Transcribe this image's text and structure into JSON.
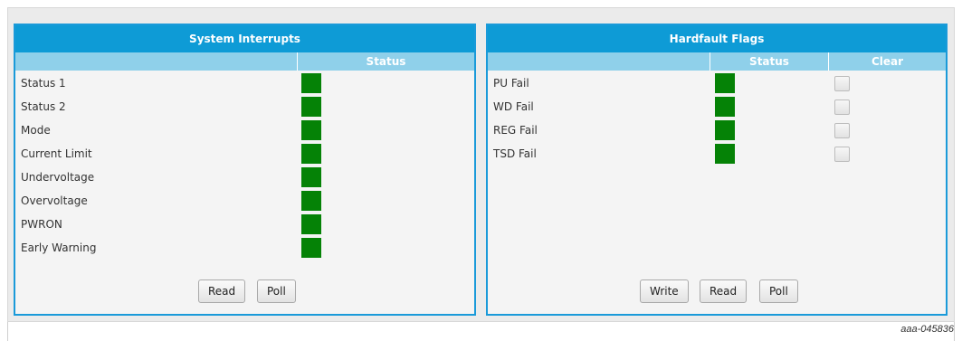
{
  "system_interrupts": {
    "title": "System Interrupts",
    "columns": [
      "",
      "Status"
    ],
    "rows": [
      {
        "label": "Status 1",
        "status_color": "#058206"
      },
      {
        "label": "Status 2",
        "status_color": "#058206"
      },
      {
        "label": "Mode",
        "status_color": "#058206"
      },
      {
        "label": "Current Limit",
        "status_color": "#058206"
      },
      {
        "label": "Undervoltage",
        "status_color": "#058206"
      },
      {
        "label": "Overvoltage",
        "status_color": "#058206"
      },
      {
        "label": "PWRON",
        "status_color": "#058206"
      },
      {
        "label": "Early Warning",
        "status_color": "#058206"
      }
    ],
    "buttons": {
      "read": "Read",
      "poll": "Poll"
    }
  },
  "hardfault_flags": {
    "title": "Hardfault Flags",
    "columns": [
      "",
      "Status",
      "Clear"
    ],
    "rows": [
      {
        "label": "PU Fail",
        "status_color": "#058206",
        "clear_checked": false
      },
      {
        "label": "WD Fail",
        "status_color": "#058206",
        "clear_checked": false
      },
      {
        "label": "REG Fail",
        "status_color": "#058206",
        "clear_checked": false
      },
      {
        "label": "TSD Fail",
        "status_color": "#058206",
        "clear_checked": false
      }
    ],
    "buttons": {
      "write": "Write",
      "read": "Read",
      "poll": "Poll"
    }
  },
  "caption": "aaa-045836",
  "colors": {
    "accent": "#0e9bd6",
    "header": "#8fd0ea",
    "status_ok": "#058206"
  }
}
